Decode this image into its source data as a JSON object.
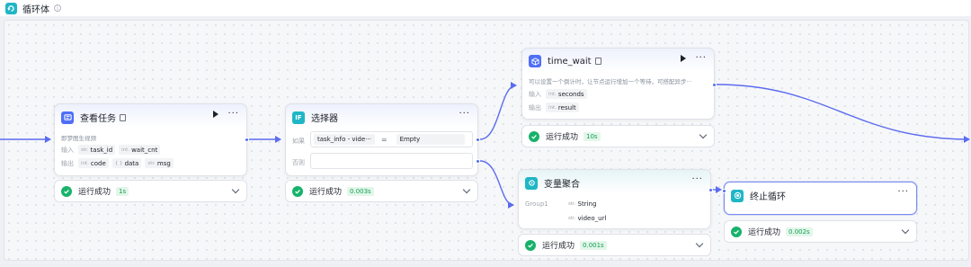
{
  "header": {
    "title": "循环体",
    "info": "i"
  },
  "nodes": {
    "view_task": {
      "title": "查看任务",
      "description": "即梦图生视频",
      "input_label": "输入",
      "inputs": [
        {
          "type": "str.",
          "name": "task_id"
        },
        {
          "type": "int.",
          "name": "wait_cnt"
        }
      ],
      "output_label": "输出",
      "outputs": [
        {
          "type": "int.",
          "name": "code"
        },
        {
          "type": "{ }",
          "name": "data"
        },
        {
          "type": "str.",
          "name": "msg"
        }
      ],
      "status": {
        "text": "运行成功",
        "time": "1s"
      }
    },
    "selector": {
      "title": "选择器",
      "if_label": "如果",
      "condition_var": "task_info - vide···",
      "operator": "=",
      "condition_value": "Empty",
      "else_label": "否则",
      "status": {
        "text": "运行成功",
        "time": "0.003s"
      }
    },
    "time_wait": {
      "title": "time_wait",
      "description": "可以设置一个倒计时，让节点运行增加一个等待，可搭配异步···",
      "input_label": "输入",
      "inputs": [
        {
          "type": "int.",
          "name": "seconds"
        }
      ],
      "output_label": "输出",
      "outputs": [
        {
          "type": "int.",
          "name": "result"
        }
      ],
      "status": {
        "text": "运行成功",
        "time": "10s"
      }
    },
    "var_merge": {
      "title": "变量聚合",
      "group_label": "Group1",
      "items": [
        {
          "type": "str.",
          "name": "String"
        },
        {
          "type": "str.",
          "name": "video_url"
        }
      ],
      "status": {
        "text": "运行成功",
        "time": "0.001s"
      }
    },
    "stop_loop": {
      "title": "终止循环",
      "status": {
        "text": "运行成功",
        "time": "0.002s"
      }
    }
  },
  "colors": {
    "accent": "#4f6ef7",
    "loop_teal": "#1fb6c5",
    "success": "#17b26a",
    "success_badge_bg": "#e3f6ea"
  },
  "icons": {
    "loop": "loop-icon",
    "task": "plugin-icon",
    "selector": "if-icon",
    "time_wait": "plugin-cube-icon",
    "merge": "merge-icon",
    "stop": "stop-icon",
    "success": "check-circle-icon",
    "expand": "chevron-down-icon",
    "more": "more-icon",
    "run": "play-icon"
  }
}
